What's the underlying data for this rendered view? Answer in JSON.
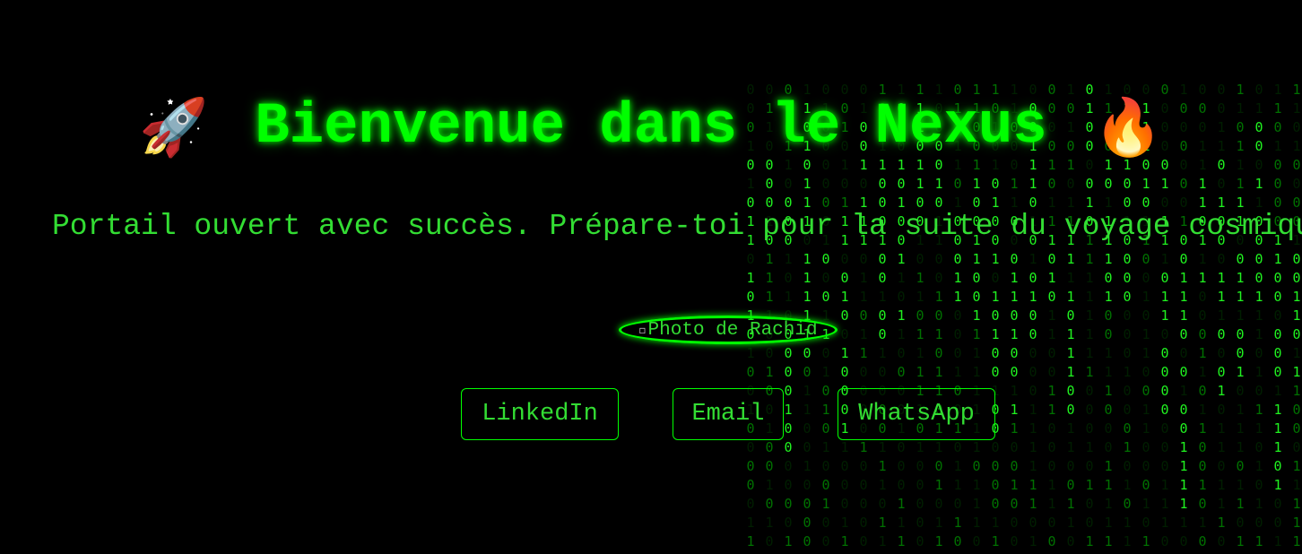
{
  "hero": {
    "title": "Bienvenue dans le Nexus",
    "left_icon": "rocket-emoji-icon",
    "right_icon": "fire-emoji-icon",
    "subtitle": "Portail ouvert avec succès. Prépare-toi pour la suite du voyage cosmique"
  },
  "profile": {
    "photo_alt": "Photo de Rachid",
    "icon": "broken-image-icon"
  },
  "links": [
    {
      "label": "LinkedIn"
    },
    {
      "label": "Email"
    },
    {
      "label": "WhatsApp"
    }
  ],
  "colors": {
    "background": "#000000",
    "accent": "#00ff00"
  }
}
